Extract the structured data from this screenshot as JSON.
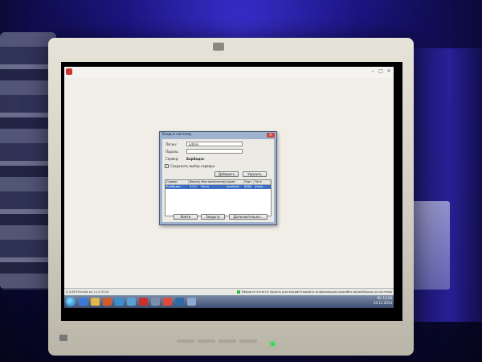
{
  "dialog": {
    "title": "Вход в систему",
    "login_label": "Логин:",
    "login_value": "admin",
    "password_label": "Пароль:",
    "server_label": "Сервер:",
    "server_value": "Барбадос",
    "remember_label": "Сохранить выбор сервера",
    "add_button": "Добавить",
    "delete_button": "Удалить",
    "table_headers": [
      "Сервер",
      "Версия",
      "Имя компьютера",
      "Адрес",
      "Порт",
      "Путь"
    ],
    "row": [
      "Барбадос",
      "5.5.1",
      "Parus",
      "localhost",
      "8080",
      "/resto"
    ],
    "ok_button": "Войти",
    "close_button": "Закрыть",
    "extra_button": "Дополнительно..."
  },
  "status": {
    "left": "4.4.6576 build on 1 Jul 2014",
    "mid": "Введите логин и пароль для входа",
    "right": "Отправить информацию разработчикам",
    "far": "Выход из системы"
  },
  "tray": {
    "lang": "RU",
    "time": "13:29",
    "date": "24.11.2014"
  },
  "colors": {
    "ambient_light": "#2a22c8",
    "power_led": "#27e04b",
    "selection": "#3a6fc4"
  }
}
